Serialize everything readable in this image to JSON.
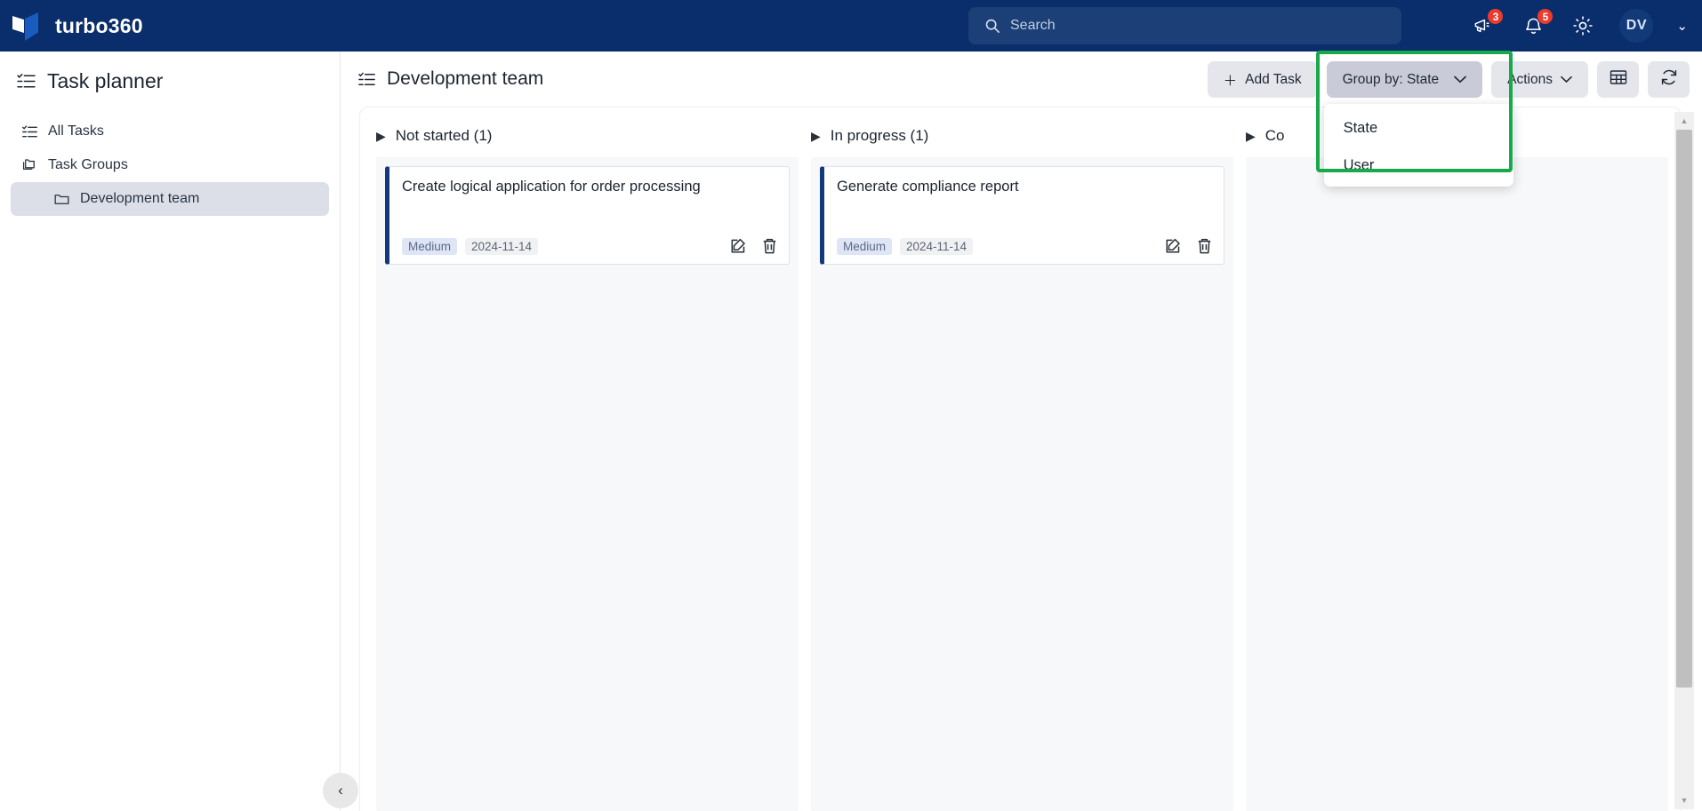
{
  "topbar": {
    "brand_name": "turbo360",
    "logo_icon": "turbo360-logo-icon",
    "search": {
      "placeholder": "Search",
      "value": "",
      "icon": "search-icon"
    },
    "announcements": {
      "icon": "megaphone-icon",
      "badge": "3"
    },
    "notifications": {
      "icon": "bell-icon",
      "badge": "5"
    },
    "settings": {
      "icon": "gear-icon"
    },
    "account": {
      "initials": "DV",
      "chevron_icon": "chevron-down-icon"
    }
  },
  "sidebar": {
    "title": "Task planner",
    "title_icon": "checklist-icon",
    "items": [
      {
        "label": "All Tasks",
        "icon": "checklist-icon",
        "active": false
      },
      {
        "label": "Task Groups",
        "icon": "folders-icon",
        "active": false
      },
      {
        "label": "Development team",
        "icon": "folder-icon",
        "active": true
      }
    ],
    "collapse_icon": "chevron-left-icon"
  },
  "main": {
    "board_title": "Development team",
    "board_title_icon": "checklist-icon",
    "toolbar": {
      "add_task_label": "Add Task",
      "add_task_icon": "plus-icon",
      "group_by_label": "Group by: State",
      "group_by_chevron": "chevron-down-icon",
      "actions_label": "Actions",
      "actions_chevron": "chevron-down-icon",
      "grid_view_icon": "table-grid-icon",
      "refresh_icon": "refresh-icon"
    },
    "group_by_dropdown": {
      "open": true,
      "highlighted": true,
      "highlight_color": "#18a94b",
      "options": [
        "State",
        "User"
      ]
    },
    "columns": [
      {
        "title": "Not started (1)",
        "collapse_icon": "triangle-right-icon",
        "cards": [
          {
            "title": "Create logical application for order processing",
            "priority": "Medium",
            "date": "2024-11-14",
            "edit_icon": "edit-pencil-icon",
            "delete_icon": "trash-icon"
          }
        ]
      },
      {
        "title": "In progress (1)",
        "collapse_icon": "triangle-right-icon",
        "cards": [
          {
            "title": "Generate compliance report",
            "priority": "Medium",
            "date": "2024-11-14",
            "edit_icon": "edit-pencil-icon",
            "delete_icon": "trash-icon"
          }
        ]
      },
      {
        "title": "Co",
        "collapse_icon": "triangle-right-icon",
        "cards": []
      }
    ],
    "scrollbar": {
      "up_icon": "caret-up-icon",
      "down_icon": "caret-down-icon"
    }
  },
  "colors": {
    "topbar_bg": "#0a2e6b",
    "accent_card_border": "#13387d",
    "badge_red": "#ec3b2d",
    "highlight_green": "#18a94b"
  }
}
